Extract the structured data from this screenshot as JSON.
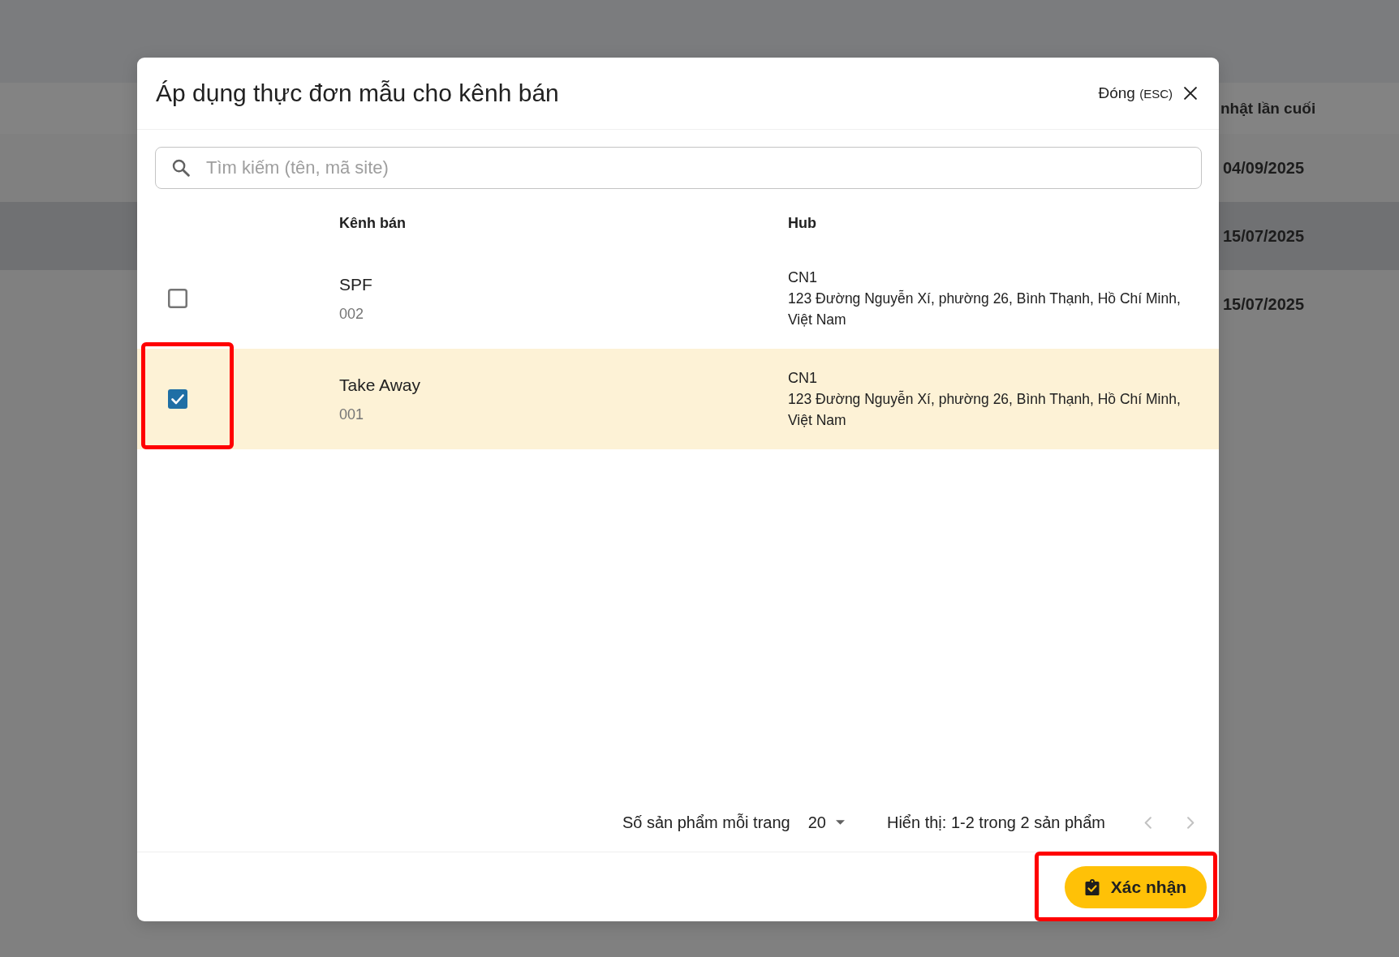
{
  "background_table": {
    "header": "nhật lần cuối",
    "rows": [
      {
        "date": "04/09/2025",
        "highlighted": false
      },
      {
        "date": "15/07/2025",
        "highlighted": true
      },
      {
        "date": "15/07/2025",
        "highlighted": false
      }
    ]
  },
  "dialog": {
    "title": "Áp dụng thực đơn mẫu cho kênh bán",
    "close": {
      "label": "Đóng",
      "shortcut": "(ESC)"
    },
    "search": {
      "placeholder": "Tìm kiếm (tên, mã site)"
    },
    "table": {
      "columns": [
        "Kênh bán",
        "Hub"
      ],
      "rows": [
        {
          "name": "SPF",
          "code": "002",
          "hub": "CN1",
          "address": "123 Đường Nguyễn Xí, phường 26, Bình Thạnh, Hồ Chí Minh, Việt Nam",
          "checked": false,
          "annotated": false
        },
        {
          "name": "Take Away",
          "code": "001",
          "hub": "CN1",
          "address": "123 Đường Nguyễn Xí, phường 26, Bình Thạnh, Hồ Chí Minh, Việt Nam",
          "checked": true,
          "annotated": true
        }
      ]
    },
    "pagination": {
      "page_size_label": "Số sản phẩm mỗi trang",
      "page_size": "20",
      "summary": "Hiển thị: 1-2 trong 2 sản phẩm",
      "prev_disabled": true,
      "next_disabled": true
    },
    "confirm_button": {
      "label": "Xác nhận",
      "annotated": true
    }
  }
}
